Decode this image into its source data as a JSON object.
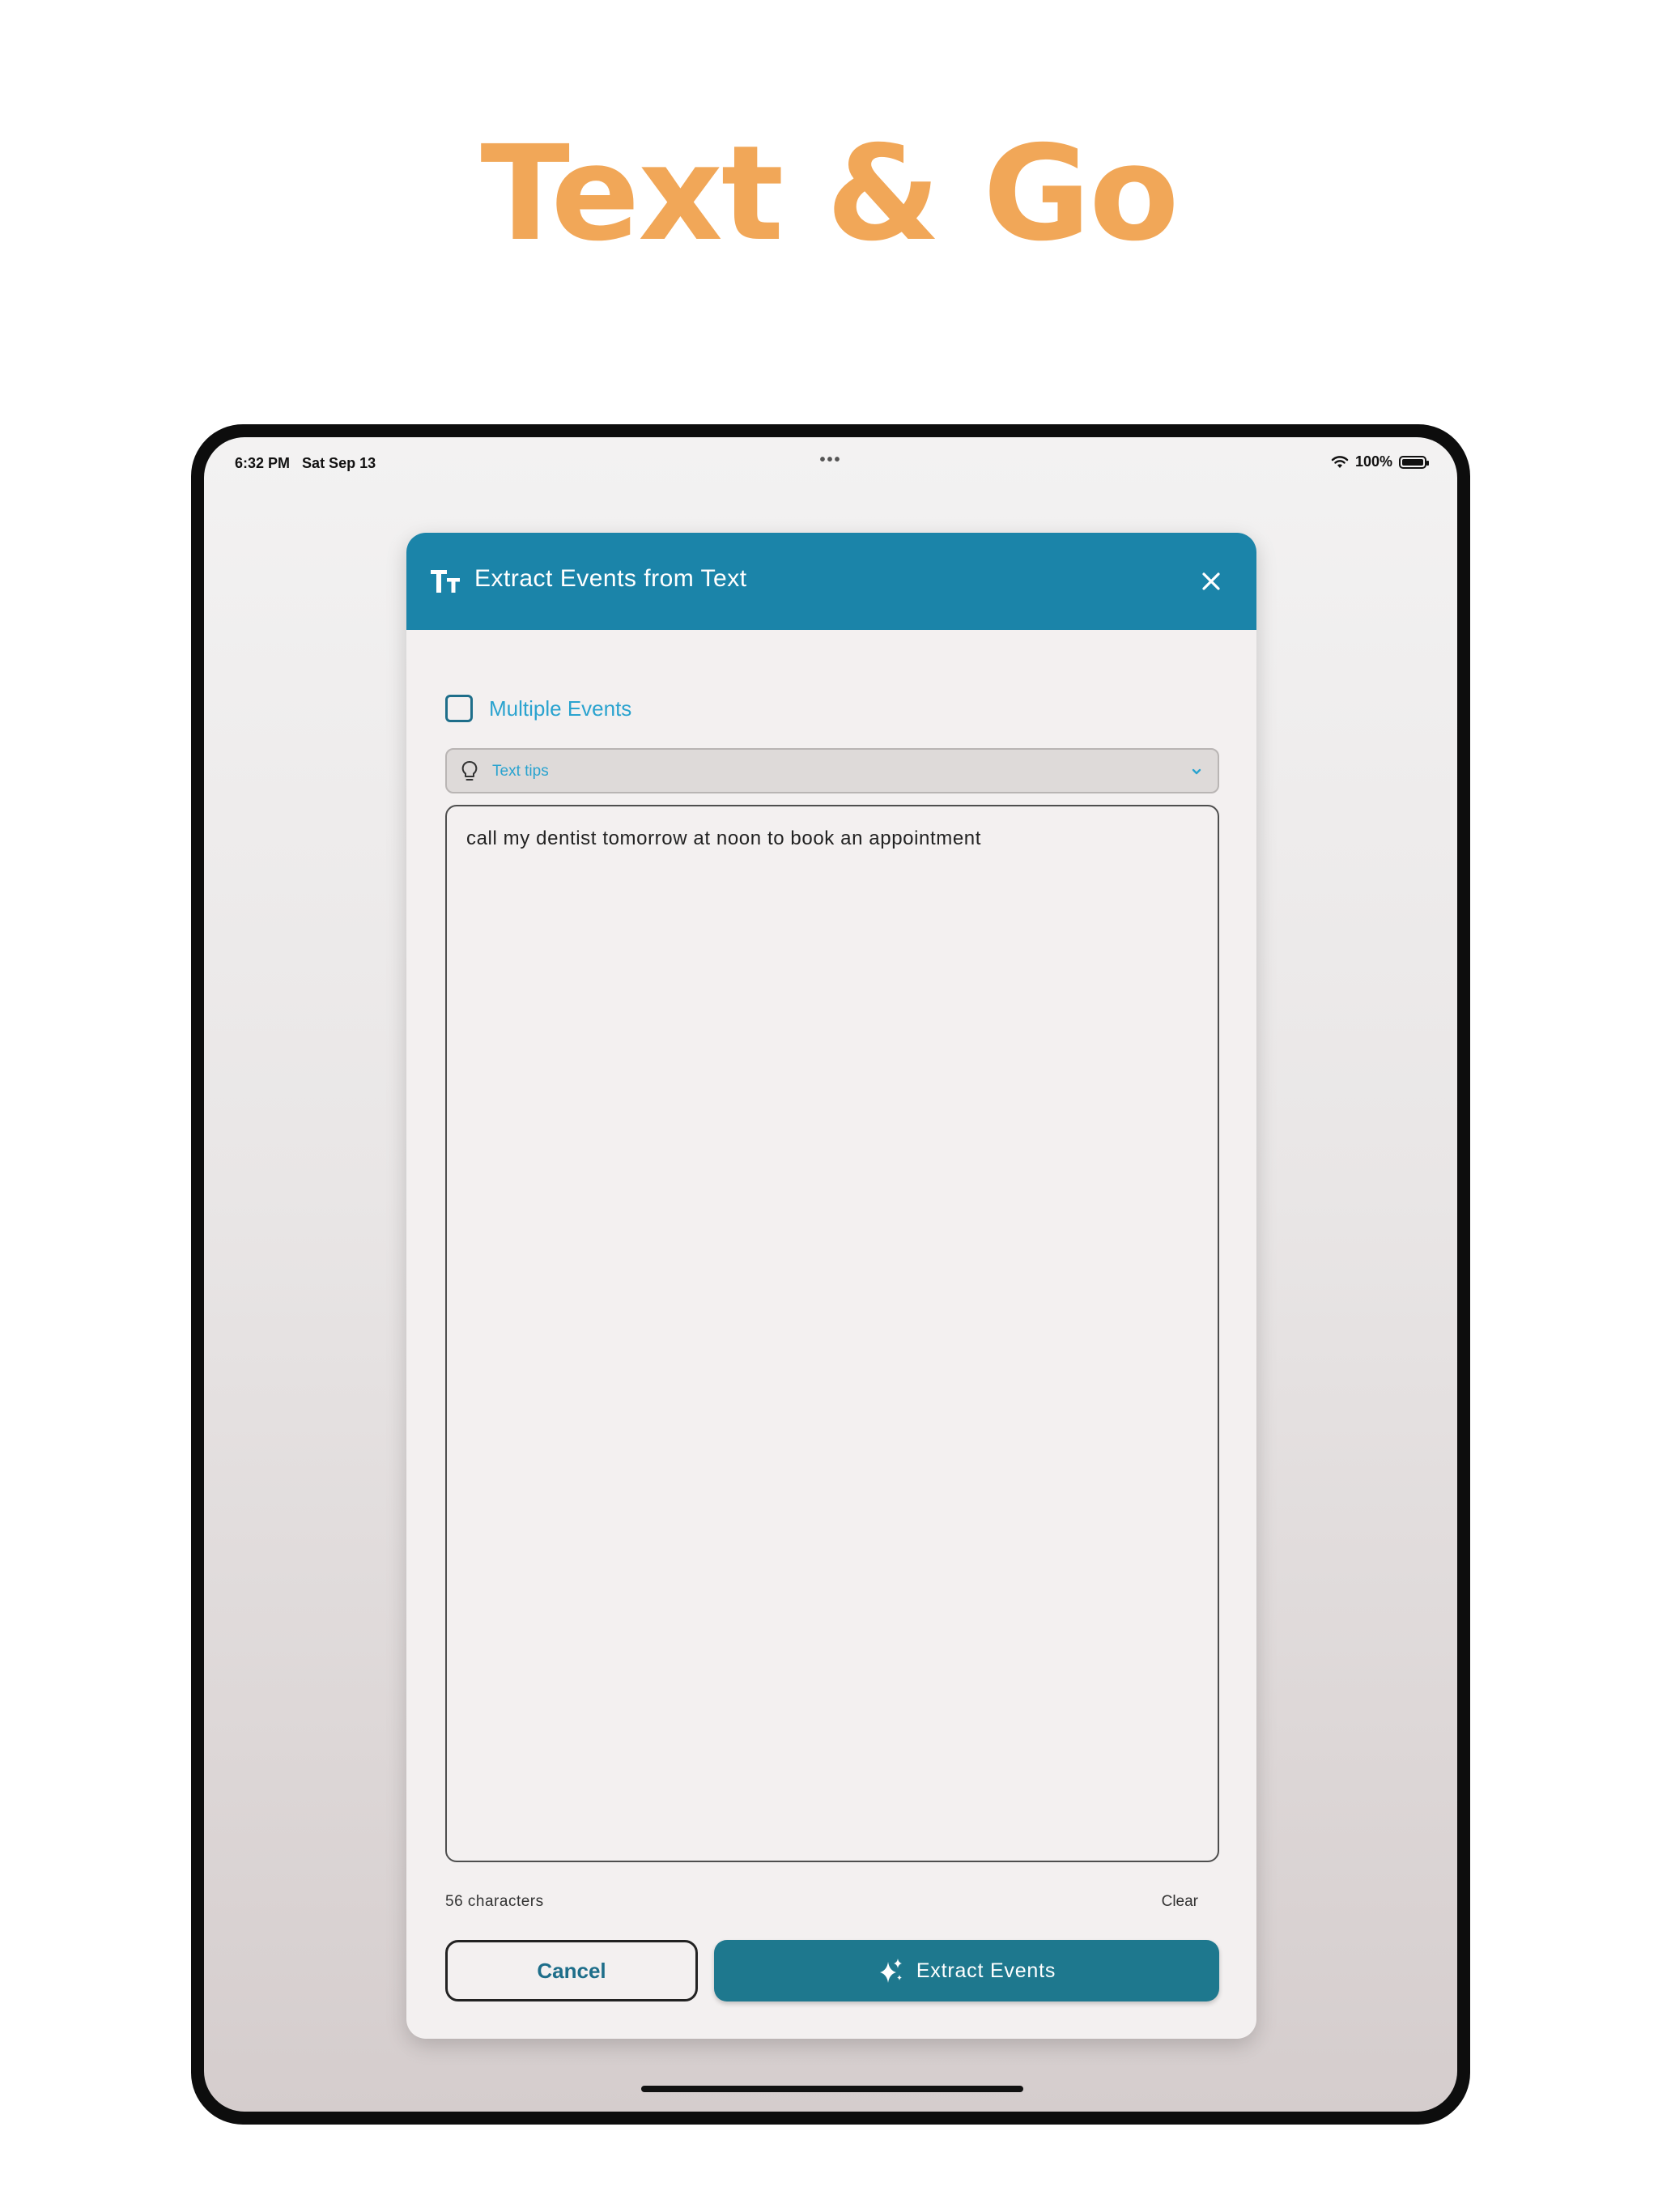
{
  "headline": "Text & Go",
  "status_bar": {
    "time": "6:32 PM",
    "date": "Sat Sep 13",
    "battery_text": "100%",
    "battery_icon": "battery-full-icon",
    "wifi_icon": "wifi-icon"
  },
  "dialog": {
    "title": "Extract Events from Text",
    "title_icon": "text-size-icon",
    "close_icon": "close-icon",
    "multiple_events_label": "Multiple Events",
    "multiple_events_checked": false,
    "tips_label": "Text tips",
    "input_text": "call my dentist tomorrow at noon to book an appointment",
    "char_count": "56 characters",
    "clear_label": "Clear",
    "cancel_label": "Cancel",
    "extract_label": "Extract Events",
    "extract_icon": "sparkle-icon"
  },
  "colors": {
    "headline": "#F1A758",
    "header_bg": "#1B84A9",
    "accent_text": "#2AA3CF",
    "primary_button": "#1E788E"
  }
}
